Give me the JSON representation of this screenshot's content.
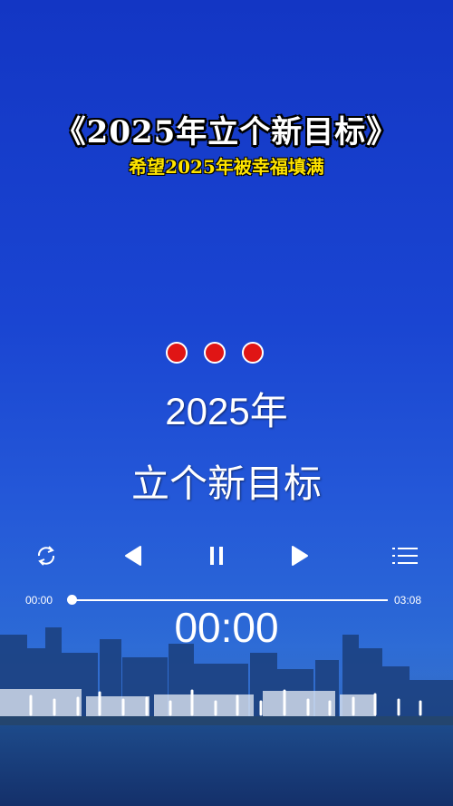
{
  "header": {
    "title": "《2025年立个新目标》",
    "subtitle": "希望2025年被幸福填满"
  },
  "lyrics": {
    "line1": "2025年",
    "line2": "立个新目标"
  },
  "player": {
    "time_current": "00:00",
    "time_total": "03:08",
    "display_time": "00:00",
    "progress": 0,
    "controls": [
      "repeat-icon",
      "previous-icon",
      "pause-icon",
      "next-icon",
      "playlist-icon"
    ]
  },
  "colors": {
    "background": "#1a45d2",
    "title_text": "#ffffff",
    "subtitle_text": "#ffe400",
    "dot": "#e01515"
  }
}
